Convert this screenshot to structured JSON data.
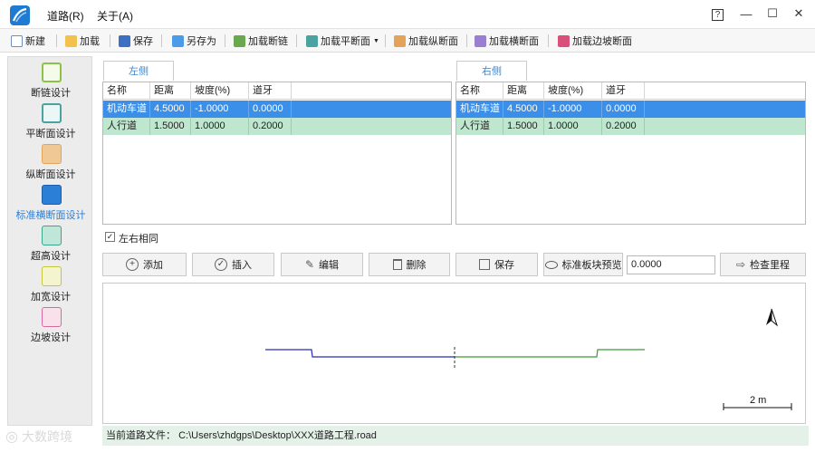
{
  "menu": {
    "road": "道路(R)",
    "about": "关于(A)"
  },
  "window_controls": {
    "help": "?",
    "minimize": "—",
    "maximize": "☐",
    "close": "✕"
  },
  "toolbar": {
    "new": "新建",
    "load": "加载",
    "save": "保存",
    "save_as": "另存为",
    "load_chain_break": "加载断链",
    "load_plan_section": "加载平断面",
    "load_profile_section": "加载纵断面",
    "load_cross_section": "加载横断面",
    "load_slope_section": "加载边坡断面"
  },
  "sidebar": {
    "items": [
      {
        "label": "断链设计",
        "icon": "chain-break-icon",
        "color": "#8bc34a"
      },
      {
        "label": "平断面设计",
        "icon": "plan-section-icon",
        "color": "#4aa3a0"
      },
      {
        "label": "纵断面设计",
        "icon": "profile-section-icon",
        "color": "#e3a45a"
      },
      {
        "label": "标准横断面设计",
        "icon": "cross-section-icon",
        "color": "#2b7fd6",
        "active": true
      },
      {
        "label": "超高设计",
        "icon": "superelevation-icon",
        "color": "#3aa78a"
      },
      {
        "label": "加宽设计",
        "icon": "widening-icon",
        "color": "#c4c640"
      },
      {
        "label": "边坡设计",
        "icon": "slope-icon",
        "color": "#d96aa0"
      }
    ]
  },
  "left_panel": {
    "tab": "左侧",
    "columns": [
      "名称",
      "距离",
      "坡度(%)",
      "道牙"
    ],
    "rows": [
      [
        "机动车道",
        "4.5000",
        "-1.0000",
        "0.0000"
      ],
      [
        "人行道",
        "1.5000",
        "1.0000",
        "0.2000"
      ]
    ]
  },
  "right_panel": {
    "tab": "右侧",
    "columns": [
      "名称",
      "距离",
      "坡度(%)",
      "道牙"
    ],
    "rows": [
      [
        "机动车道",
        "4.5000",
        "-1.0000",
        "0.0000"
      ],
      [
        "人行道",
        "1.5000",
        "1.0000",
        "0.2000"
      ]
    ]
  },
  "same_both_sides": {
    "label": "左右相同",
    "checked": true
  },
  "buttons": {
    "add": "添加",
    "insert": "插入",
    "edit": "编辑",
    "delete": "删除",
    "save": "保存",
    "preview": "标准板块预览",
    "mileage_value": "0.0000",
    "check_mileage": "检查里程"
  },
  "canvas": {
    "scale_label": "2 m",
    "north_label": ""
  },
  "status": {
    "label": "当前道路文件：",
    "path": "C:\\Users\\zhdgps\\Desktop\\XXX道路工程.road"
  },
  "watermark": {
    "text": "大数跨境"
  }
}
